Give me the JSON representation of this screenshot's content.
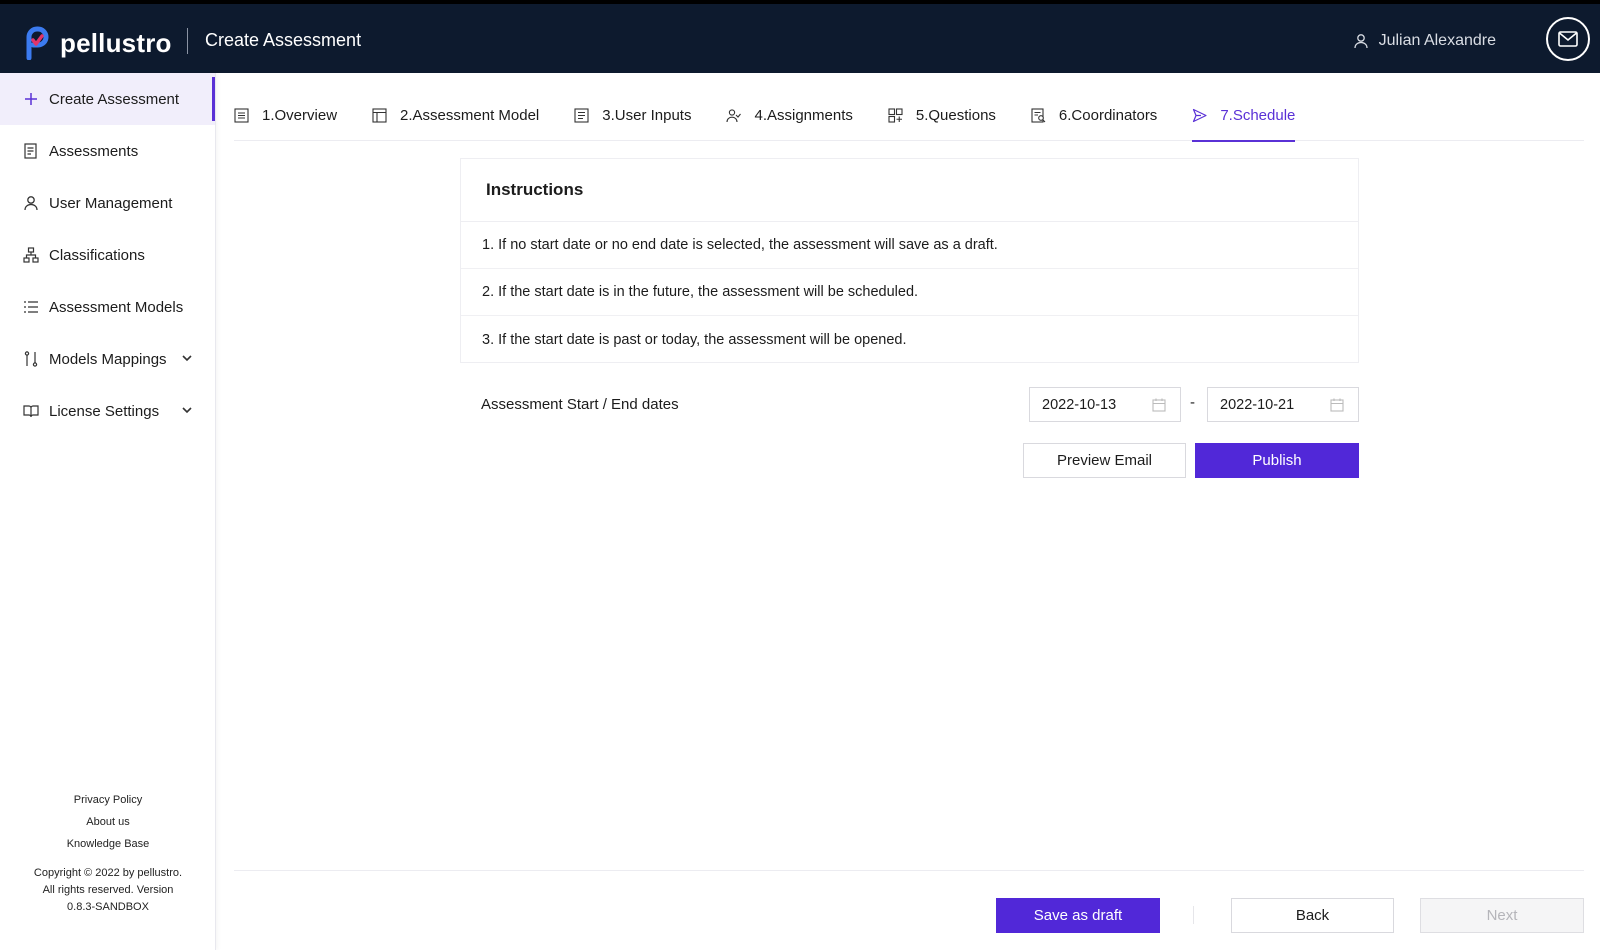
{
  "header": {
    "brand": "pellustro",
    "title": "Create Assessment",
    "user_name": "Julian Alexandre",
    "colors": {
      "header_bg": "#0d1a2e",
      "accent": "#5128d8"
    }
  },
  "sidebar": {
    "items": [
      {
        "label": "Create Assessment",
        "icon": "plus-icon"
      },
      {
        "label": "Assessments",
        "icon": "document-list-icon"
      },
      {
        "label": "User Management",
        "icon": "user-icon"
      },
      {
        "label": "Classifications",
        "icon": "hierarchy-icon"
      },
      {
        "label": "Assessment Models",
        "icon": "list-icon"
      },
      {
        "label": "Models Mappings",
        "icon": "mapping-icon"
      },
      {
        "label": "License Settings",
        "icon": "book-icon"
      }
    ],
    "footer": {
      "privacy": "Privacy Policy",
      "about": "About us",
      "kb": "Knowledge Base",
      "copyright": "Copyright © 2022 by pellustro. All rights reserved. Version 0.8.3-SANDBOX"
    }
  },
  "tabs": [
    {
      "label": "1.Overview",
      "icon": "overview-icon"
    },
    {
      "label": "2.Assessment Model",
      "icon": "layout-icon"
    },
    {
      "label": "3.User Inputs",
      "icon": "form-icon"
    },
    {
      "label": "4.Assignments",
      "icon": "users-icon"
    },
    {
      "label": "5.Questions",
      "icon": "grid-icon"
    },
    {
      "label": "6.Coordinators",
      "icon": "coordinator-icon"
    },
    {
      "label": "7.Schedule",
      "icon": "send-icon"
    }
  ],
  "instructions": {
    "title": "Instructions",
    "items": [
      "1. If no start date or no end date is selected, the assessment will save as a draft.",
      "2. If the start date is in the future, the assessment will be scheduled.",
      "3. If the start date is past or today, the assessment will be opened."
    ]
  },
  "dates": {
    "label": "Assessment Start / End dates",
    "start": "2022-10-13",
    "end": "2022-10-21",
    "separator": "-"
  },
  "actions": {
    "preview": "Preview Email",
    "publish": "Publish"
  },
  "footer_actions": {
    "save_draft": "Save as draft",
    "back": "Back",
    "next": "Next"
  }
}
